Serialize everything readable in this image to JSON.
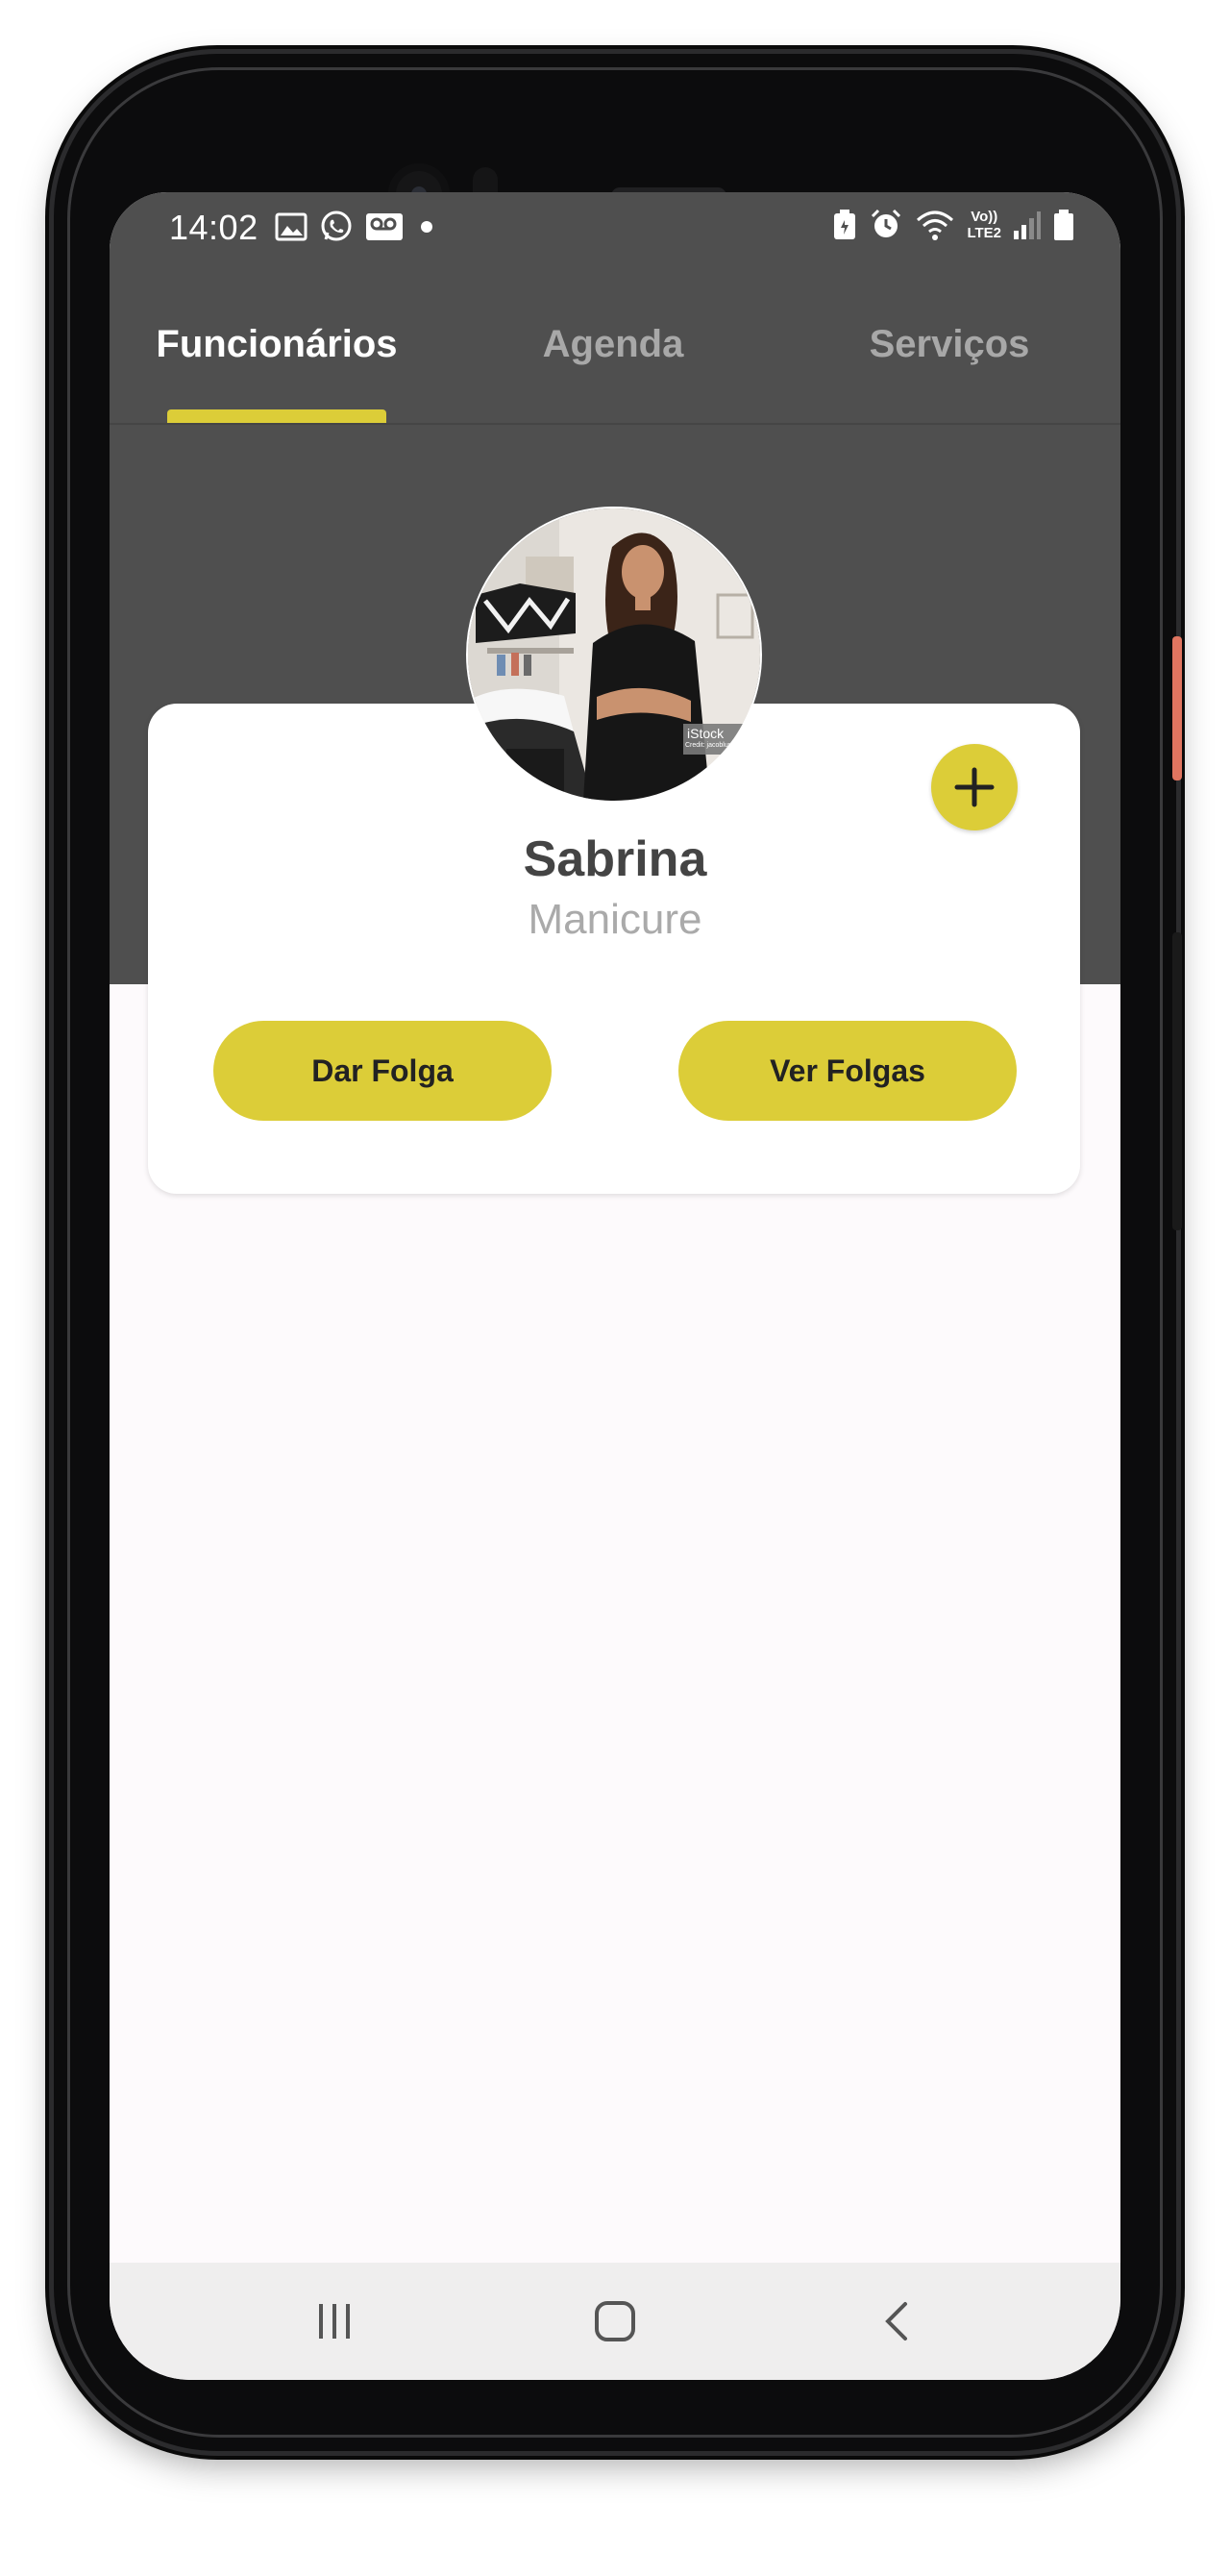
{
  "status_bar": {
    "time": "14:02",
    "network_label_top": "Vo))",
    "network_label_bottom": "LTE2",
    "left_icons": [
      "image-icon",
      "whatsapp-icon",
      "voicemail-icon",
      "dot-icon"
    ],
    "right_icons": [
      "battery-saver-icon",
      "alarm-icon",
      "wifi-icon",
      "network-label",
      "signal-icon",
      "battery-icon"
    ]
  },
  "tabs": [
    {
      "label": "Funcionários",
      "active": true
    },
    {
      "label": "Agenda",
      "active": false
    },
    {
      "label": "Serviços",
      "active": false
    }
  ],
  "employee_card": {
    "name": "Sabrina",
    "role": "Manicure",
    "photo_watermark": "iStock",
    "photo_credit": "Credit: jacoblund",
    "add_icon": "plus-icon",
    "actions": [
      {
        "label": "Dar Folga"
      },
      {
        "label": "Ver Folgas"
      }
    ]
  },
  "navigation_bar": {
    "buttons": [
      "recent-apps-icon",
      "home-icon",
      "back-icon"
    ]
  },
  "colors": {
    "accent": "#dccd38",
    "header_background": "#4f4f4f",
    "content_background": "#fdfafc",
    "card_background": "#ffffff",
    "name_text": "#444444",
    "role_text": "#aaaaaa",
    "inactive_tab": "#a8a8a8",
    "navbar_background": "#efeeee"
  }
}
